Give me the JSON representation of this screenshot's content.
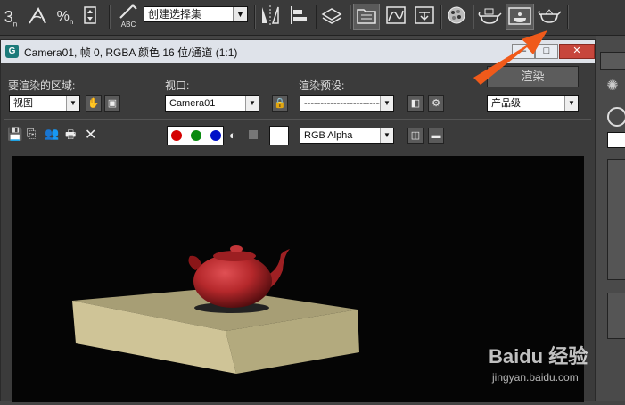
{
  "toolbar": {
    "angle_snap_label": "3",
    "percent_snap_label": "%",
    "abc_label": "ABC",
    "selection_set": {
      "value": "创建选择集",
      "arrow": "▼"
    },
    "icons": [
      "snap-3d-icon",
      "angle-snap-icon",
      "percent-snap-icon",
      "spinner-snap-icon",
      "edit-named-selection-icon",
      "mirror-icon",
      "align-icon",
      "layer-manager-icon",
      "scene-explorer-icon",
      "curve-editor-icon",
      "schematic-view-icon",
      "material-editor-icon",
      "render-setup-icon",
      "rendered-frame-window-icon",
      "render-production-icon"
    ]
  },
  "window": {
    "title": "Camera01, 帧 0, RGBA 颜色 16 位/通道 (1:1)",
    "minimize": "–",
    "maximize": "□",
    "close": "✕"
  },
  "controls": {
    "area_label": "要渲染的区域:",
    "area_value": "视图",
    "viewport_label": "视口:",
    "viewport_value": "Camera01",
    "preset_label": "渲染预设:",
    "preset_value": "-------------------------",
    "render_button": "渲染",
    "quality_value": "产品级",
    "channel_value": "RGB Alpha"
  },
  "colors": {
    "annotation_arrow": "#f05a1a",
    "teapot": "#b5282b",
    "table_top": "#a79e75",
    "table_side": "#cfc497",
    "render_bg": "#050505"
  },
  "watermark": {
    "brand": "Baidu 经验",
    "url": "jingyan.baidu.com"
  }
}
